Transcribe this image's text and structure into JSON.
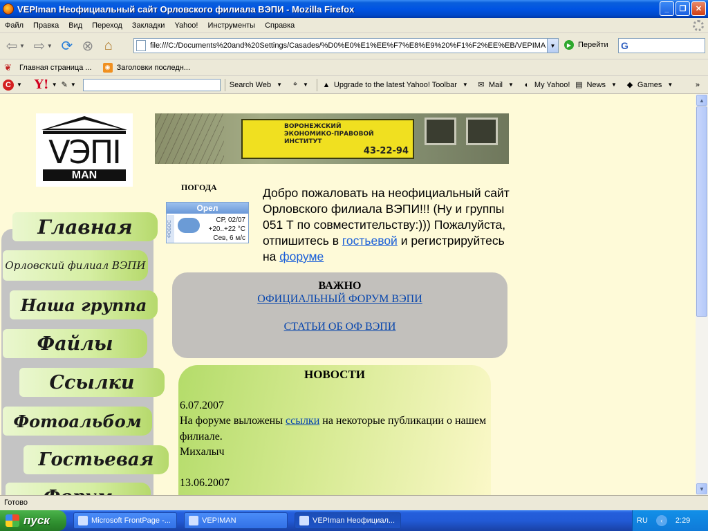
{
  "window": {
    "title": "VEPIman Неофициальный сайт Орловского филиала ВЭПИ - Mozilla Firefox",
    "minimize_icon": "minimize-icon",
    "maximize_icon": "restore-icon",
    "close_icon": "close-icon"
  },
  "menu": [
    "Файл",
    "Правка",
    "Вид",
    "Переход",
    "Закладки",
    "Yahoo!",
    "Инструменты",
    "Справка"
  ],
  "nav": {
    "url": "file:///C:/Documents%20and%20Settings/Casades/%D0%E0%E1%EE%F7%E8%E9%20%F1%F2%EE%EB/VEPIMA",
    "go_label": "Перейти",
    "search_logo": "G"
  },
  "bookmarks": [
    "Главная страница ...",
    "Заголовки последн..."
  ],
  "yahoo_toolbar": {
    "search_web": "Search Web",
    "upgrade": "Upgrade to the latest Yahoo! Toolbar",
    "mail": "Mail",
    "my_yahoo": "My Yahoo!",
    "news": "News",
    "games": "Games",
    "chevron": "»"
  },
  "page": {
    "logo": {
      "vep": "VЭПI",
      "man": "MAN"
    },
    "banner": {
      "line1": "ВОРОНЕЖСКИЙ",
      "line2": "ЭКОНОМИКО-ПРАВОВОЙ",
      "line3": "ИНСТИТУТ",
      "phone": "43-22-94"
    },
    "weather": {
      "label": "ПОГОДА",
      "city": "Орел",
      "brand": "ФОБОС",
      "date": "СР, 02/07",
      "temp": "+20..+22 °С",
      "wind": "Сев, 6 м/с"
    },
    "welcome": {
      "text1": "Добро пожаловать на неофициальный сайт Орловского филиала ВЭПИ!!! (Ну и группы 051 Т по совместительству:))) Пожалуйста, отпишитесь в ",
      "link1": "гостьевой",
      "text2": " и регистрируйтесь на ",
      "link2": "форуме"
    },
    "important": {
      "heading": "ВАЖНО",
      "link1": "ОФИЦИАЛЬНЫЙ ФОРУМ ВЭПИ",
      "link2": "СТАТЬИ ОБ ОФ ВЭПИ"
    },
    "news": {
      "heading": "НОВОСТИ",
      "items": [
        {
          "date": "6.07.2007",
          "text1": "На форуме выложены ",
          "link": "ссылки",
          "text2": " на некоторые публикации о нашем филиале.",
          "author": "Михалыч"
        },
        {
          "date": "13.06.2007"
        }
      ]
    },
    "left_nav": [
      "Главная",
      "Орловский филиал ВЭПИ",
      "Наша группа",
      "Файлы",
      "Ссылки",
      "Фотоальбом",
      "Гостьевая",
      "Форум"
    ]
  },
  "status": "Готово",
  "taskbar": {
    "start": "пуск",
    "tasks": [
      "Microsoft FrontPage -...",
      "VEPIMAN",
      "VEPIman Неофициал..."
    ],
    "lang": "RU",
    "clock": "2:29"
  }
}
